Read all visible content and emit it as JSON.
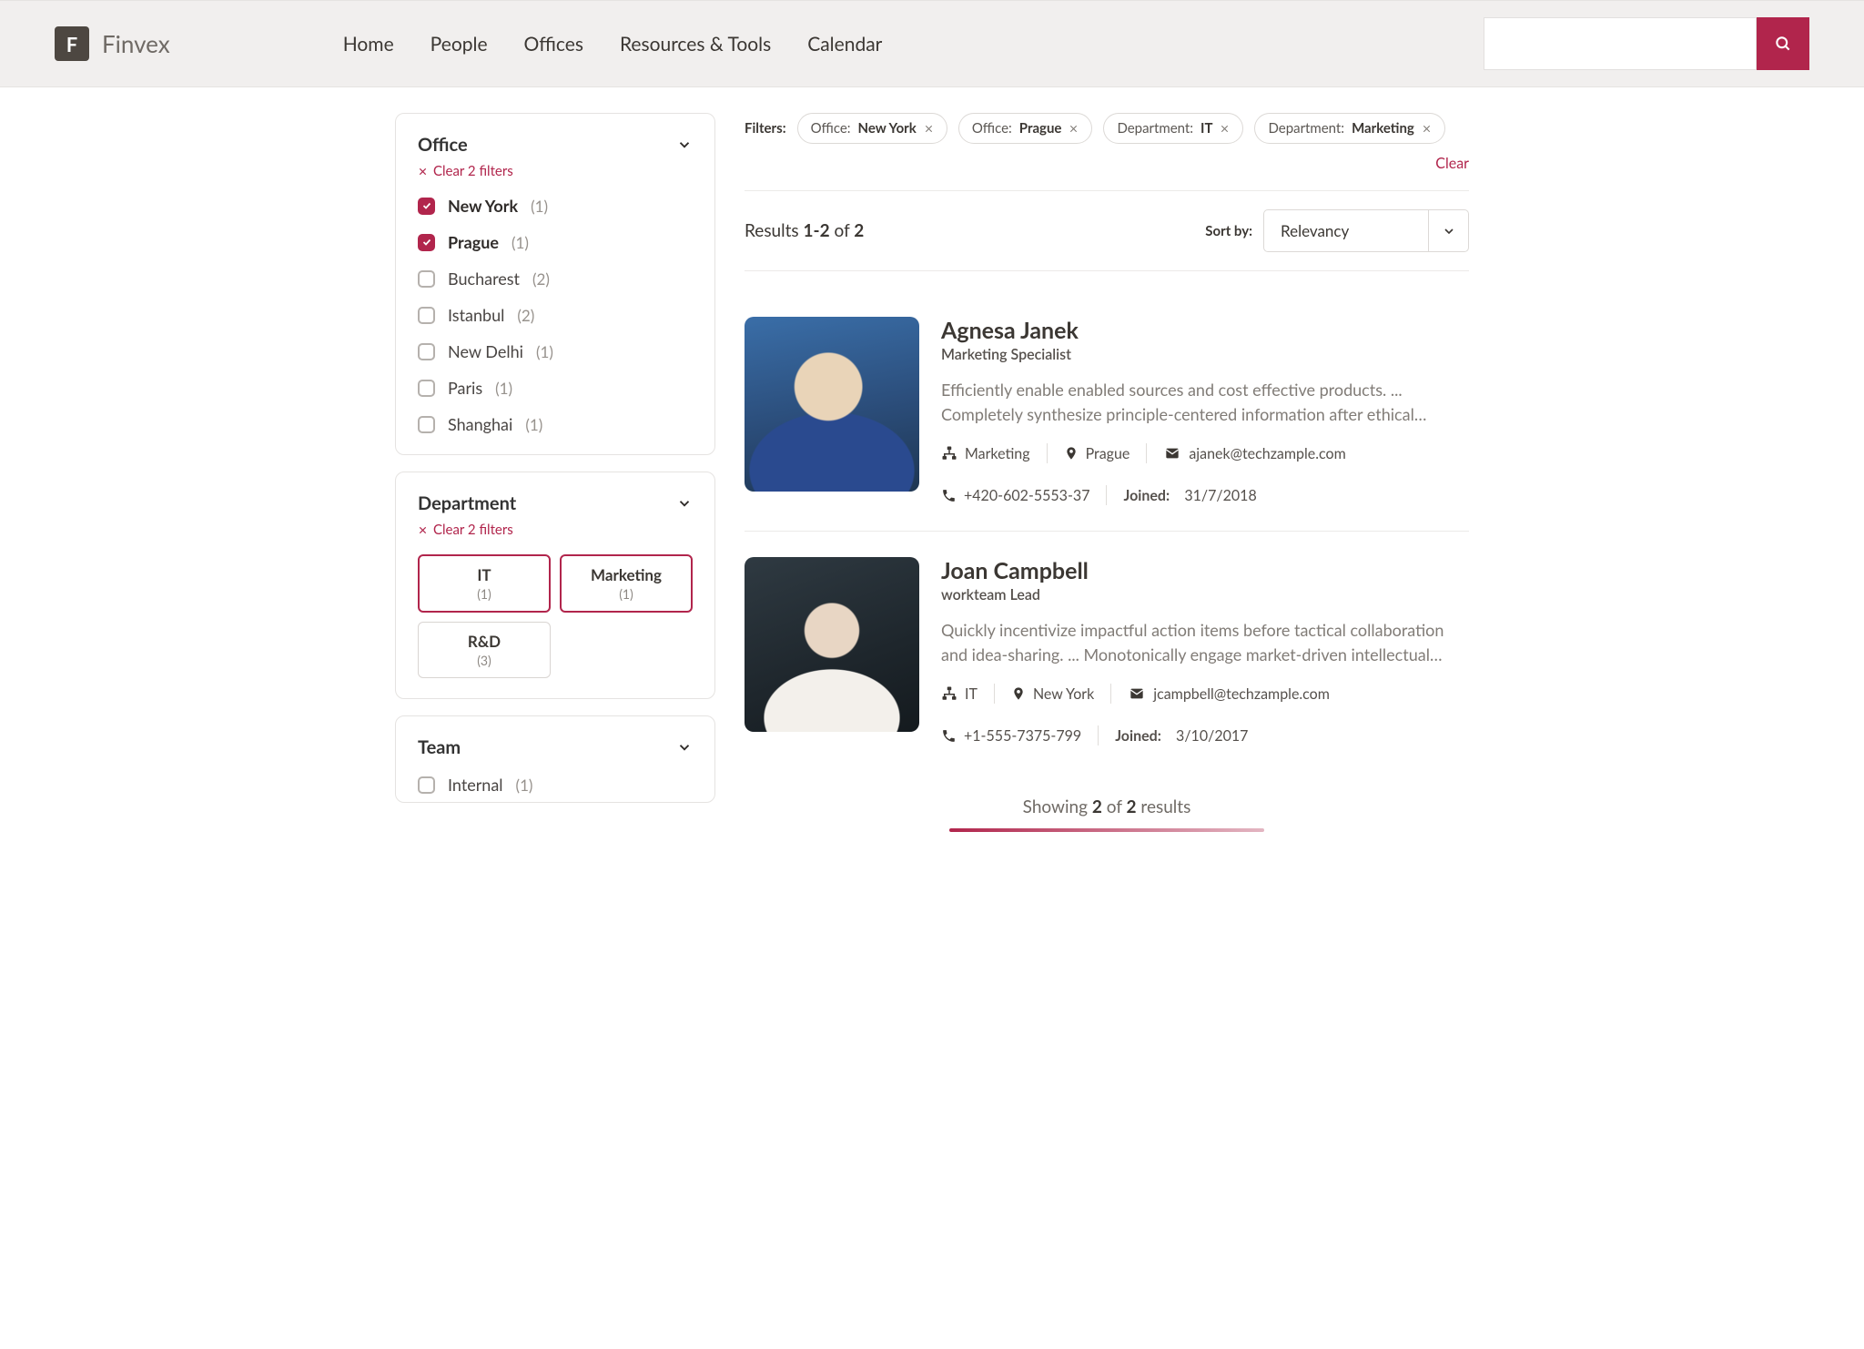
{
  "header": {
    "brand": "Finvex",
    "logoLetter": "F",
    "nav": [
      "Home",
      "People",
      "Offices",
      "Resources & Tools",
      "Calendar"
    ]
  },
  "filters": {
    "label": "Filters:",
    "clearAll": "Clear",
    "chips": [
      {
        "k": "Office",
        "v": "New York"
      },
      {
        "k": "Office",
        "v": "Prague"
      },
      {
        "k": "Department",
        "v": "IT"
      },
      {
        "k": "Department",
        "v": "Marketing"
      }
    ]
  },
  "resultsHeader": {
    "prefix": "Results ",
    "range": "1-2",
    "mid": " of ",
    "total": "2"
  },
  "sort": {
    "label": "Sort by:",
    "value": "Relevancy"
  },
  "facets": {
    "office": {
      "title": "Office",
      "clear": "Clear 2 filters",
      "items": [
        {
          "label": "New York",
          "count": "(1)",
          "checked": true
        },
        {
          "label": "Prague",
          "count": "(1)",
          "checked": true
        },
        {
          "label": "Bucharest",
          "count": "(2)",
          "checked": false
        },
        {
          "label": "Istanbul",
          "count": "(2)",
          "checked": false
        },
        {
          "label": "New Delhi",
          "count": "(1)",
          "checked": false
        },
        {
          "label": "Paris",
          "count": "(1)",
          "checked": false
        },
        {
          "label": "Shanghai",
          "count": "(1)",
          "checked": false
        }
      ]
    },
    "department": {
      "title": "Department",
      "clear": "Clear 2 filters",
      "tiles": [
        {
          "label": "IT",
          "count": "(1)",
          "selected": true
        },
        {
          "label": "Marketing",
          "count": "(1)",
          "selected": true
        },
        {
          "label": "R&D",
          "count": "(3)",
          "selected": false
        }
      ]
    },
    "team": {
      "title": "Team",
      "items": [
        {
          "label": "Internal",
          "count": "(1)",
          "checked": false
        }
      ]
    }
  },
  "people": [
    {
      "name": "Agnesa Janek",
      "role": "Marketing Specialist",
      "desc": "Efficiently enable enabled sources and cost effective products. ... Completely synthesize principle-centered information after ethical…",
      "dept": "Marketing",
      "office": "Prague",
      "email": "ajanek@techzample.com",
      "phone": "+420-602-5553-37",
      "joinedLabel": "Joined:",
      "joined": "31/7/2018"
    },
    {
      "name": "Joan Campbell",
      "role": "workteam Lead",
      "desc": "Quickly incentivize impactful action items before tactical collaboration and idea-sharing. ... Monotonically engage market-driven intellectual…",
      "dept": "IT",
      "office": "New York",
      "email": "jcampbell@techzample.com",
      "phone": "+1-555-7375-799",
      "joinedLabel": "Joined:",
      "joined": "3/10/2017"
    }
  ],
  "footer": {
    "a": "Showing ",
    "b": "2",
    "c": " of ",
    "d": "2",
    "e": " results"
  }
}
